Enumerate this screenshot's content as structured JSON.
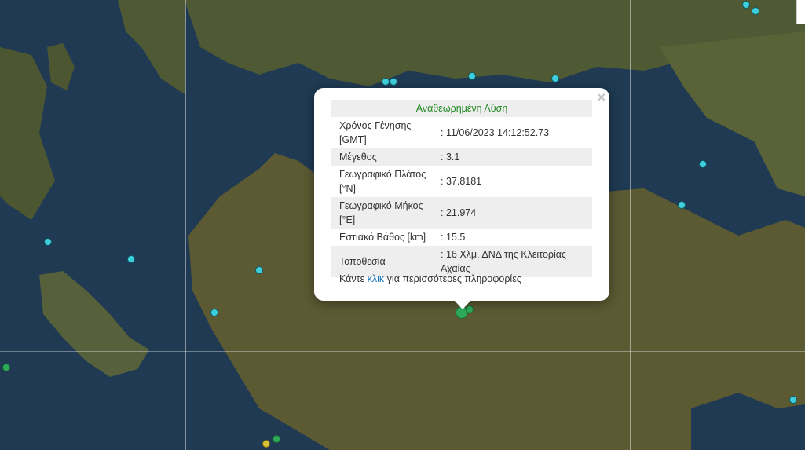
{
  "map": {
    "markers": [
      {
        "color": "cyan",
        "size": "normal"
      },
      {
        "color": "cyan",
        "size": "normal"
      },
      {
        "color": "cyan",
        "size": "normal"
      },
      {
        "color": "cyan",
        "size": "normal"
      },
      {
        "color": "cyan",
        "size": "normal"
      },
      {
        "color": "cyan",
        "size": "normal"
      },
      {
        "color": "cyan",
        "size": "normal"
      },
      {
        "color": "cyan",
        "size": "normal"
      },
      {
        "color": "cyan",
        "size": "normal"
      },
      {
        "color": "cyan",
        "size": "normal"
      },
      {
        "color": "cyan",
        "size": "normal"
      },
      {
        "color": "cyan",
        "size": "normal"
      },
      {
        "color": "cyan",
        "size": "normal"
      },
      {
        "color": "green",
        "size": "normal"
      },
      {
        "color": "green",
        "size": "normal"
      },
      {
        "color": "yellow",
        "size": "normal"
      },
      {
        "color": "green",
        "size": "big"
      },
      {
        "color": "green",
        "size": "normal"
      }
    ]
  },
  "popup": {
    "title": "Αναθεωρημένη Λύση",
    "close_symbol": "×",
    "rows": [
      {
        "key": "Χρόνος Γένησης [GMT]",
        "value": ": 11/06/2023 14:12:52.73"
      },
      {
        "key": "Μέγεθος",
        "value": ": 3.1"
      },
      {
        "key": "Γεωγραφικό Πλάτος [°N]",
        "value": ": 37.8181"
      },
      {
        "key": "Γεωγραφικό Μήκος [°E]",
        "value": ": 21.974"
      },
      {
        "key": "Εστιακό Βάθος [km]",
        "value": ": 15.5"
      },
      {
        "key": "Τοποθεσία",
        "value": ": 16 Χλμ. ΔΝΔ της Κλειτορίας Αχαΐας"
      }
    ],
    "footer_prefix": "Κάντε ",
    "footer_link": "κλικ",
    "footer_suffix": " για περισσότερες πληροφορίες"
  },
  "colors": {
    "title_green": "#238a23",
    "link_blue": "#1873b6",
    "marker_cyan": "#3fcfdc",
    "marker_green": "#2eaa5a"
  }
}
